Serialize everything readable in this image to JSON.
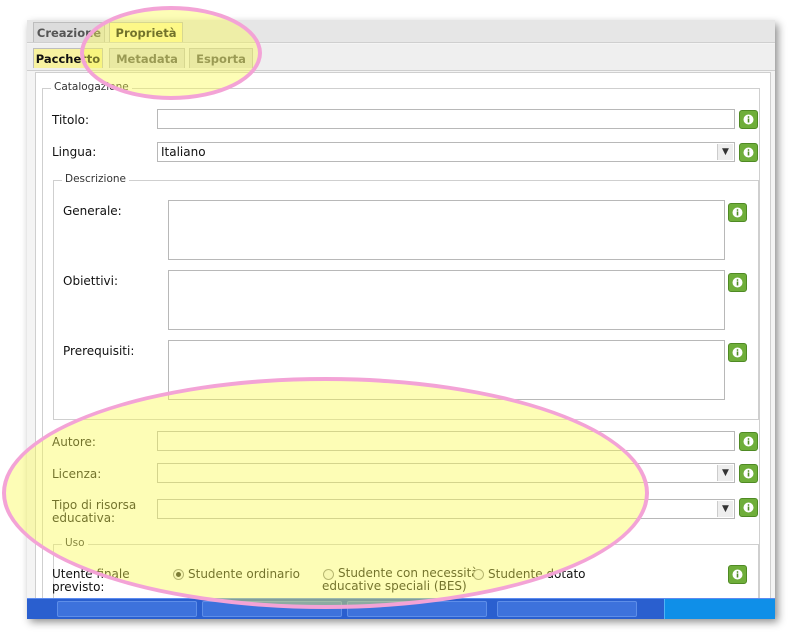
{
  "tabs_top": [
    "Creazione",
    "Proprietà"
  ],
  "tabs_sub": [
    "Pacchetto",
    "Metadata",
    "Esporta"
  ],
  "catalog": {
    "legend": "Catalogazione",
    "titolo_label": "Titolo:",
    "titolo_value": "",
    "lingua_label": "Lingua:",
    "lingua_value": "Italiano"
  },
  "descrizione": {
    "legend": "Descrizione",
    "generale_label": "Generale:",
    "obiettivi_label": "Obiettivi:",
    "prerequisiti_label": "Prerequisiti:"
  },
  "meta": {
    "autore_label": "Autore:",
    "licenza_label": "Licenza:",
    "tipo_label": "Tipo di risorsa educativa:"
  },
  "uso": {
    "legend": "Uso",
    "utente_label": "Utente finale previsto:",
    "options": [
      "Studente ordinario",
      "Studente con necessità educative speciali (BES)",
      "Studente dotato"
    ],
    "selected": "Studente ordinario"
  },
  "colors": {
    "info_green": "#6fae3a",
    "highlight_fill": "#fafa50",
    "highlight_stroke": "#f3a3d6",
    "taskbar_blue": "#2a5fcf"
  },
  "icons": {
    "info": "info-icon",
    "dropdown": "chevron-down-icon"
  }
}
